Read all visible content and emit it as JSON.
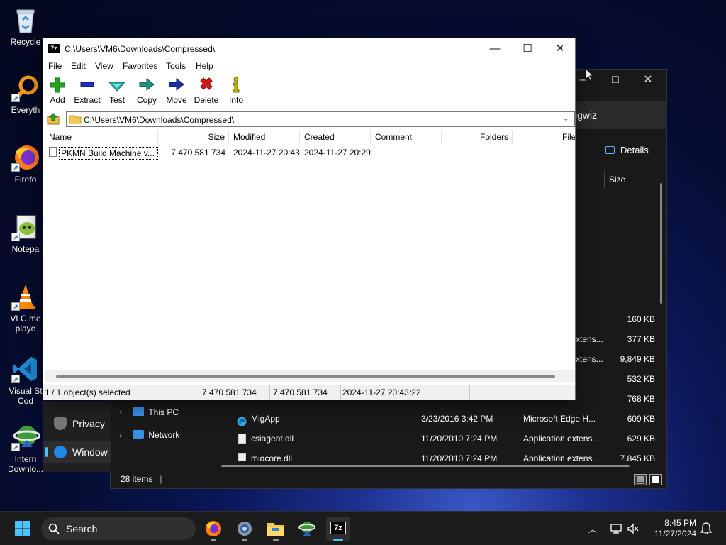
{
  "desktop": {
    "icons": [
      {
        "label": "Recycle",
        "icon": "recycle-bin-icon"
      },
      {
        "label": "Everyth",
        "icon": "everything-search-icon"
      },
      {
        "label": "Firefo",
        "icon": "firefox-icon"
      },
      {
        "label": "Notepa",
        "icon": "notepad-plus-plus-icon"
      },
      {
        "label": "VLC me\nplaye",
        "icon": "vlc-icon"
      },
      {
        "label": "Visual St\nCod",
        "icon": "vscode-icon"
      },
      {
        "label": "Intern\nDownlo...",
        "icon": "internet-download-manager-icon"
      }
    ]
  },
  "background_explorer": {
    "address_fragment": "igwiz",
    "details_label": "Details",
    "size_header": "Size",
    "rows": [
      {
        "name": "",
        "date": "",
        "type": "",
        "size": "160 KB"
      },
      {
        "name": "",
        "date": "",
        "type": "xtens...",
        "size": "377 KB"
      },
      {
        "name": "",
        "date": "",
        "type": "xtens...",
        "size": "9,849 KB"
      },
      {
        "name": "",
        "date": "",
        "type": "",
        "size": "532 KB"
      },
      {
        "name": "",
        "date": "",
        "type": "",
        "size": "768 KB"
      },
      {
        "name": "MigApp",
        "date": "3/23/2016 3:42 PM",
        "type": "Microsoft Edge H...",
        "size": "609 KB"
      },
      {
        "name": "csiagent.dll",
        "date": "11/20/2010 7:24 PM",
        "type": "Application extens...",
        "size": "629 KB"
      },
      {
        "name": "migcore.dll",
        "date": "11/20/2010 7:24 PM",
        "type": "Application extens...",
        "size": "7,845 KB"
      }
    ],
    "nav": [
      {
        "label": "This PC",
        "icon": "this-pc-icon"
      },
      {
        "label": "Network",
        "icon": "network-icon"
      }
    ],
    "status": "28 items"
  },
  "settings_window": {
    "items": [
      {
        "label": "Privacy",
        "icon": "shield-icon"
      },
      {
        "label": "Window",
        "icon": "windows-update-icon"
      }
    ]
  },
  "zip": {
    "title": "C:\\Users\\VM6\\Downloads\\Compressed\\",
    "menu": [
      "File",
      "Edit",
      "View",
      "Favorites",
      "Tools",
      "Help"
    ],
    "toolbar": [
      {
        "label": "Add",
        "icon": "add-plus-icon",
        "color": "#1fa51f"
      },
      {
        "label": "Extract",
        "icon": "extract-minus-icon",
        "color": "#1f2fb8"
      },
      {
        "label": "Test",
        "icon": "test-check-icon",
        "color": "#27b3b3"
      },
      {
        "label": "Copy",
        "icon": "copy-arrow-icon",
        "color": "#1f8f7f"
      },
      {
        "label": "Move",
        "icon": "move-arrow-icon",
        "color": "#1a2fa0"
      },
      {
        "label": "Delete",
        "icon": "delete-x-icon",
        "color": "#d21818"
      },
      {
        "label": "Info",
        "icon": "info-icon",
        "color": "#c6b400"
      }
    ],
    "address": "C:\\Users\\VM6\\Downloads\\Compressed\\",
    "columns": [
      "Name",
      "Size",
      "Modified",
      "Created",
      "Comment",
      "Folders",
      "File"
    ],
    "files": [
      {
        "name": "PKMN Build Machine v...",
        "size": "7 470 581 734",
        "modified": "2024-11-27 20:43",
        "created": "2024-11-27 20:29",
        "comment": "",
        "folders": ""
      }
    ],
    "status": {
      "selected": "1 / 1 object(s) selected",
      "size1": "7 470 581 734",
      "size2": "7 470 581 734",
      "datetime": "2024-11-27 20:43:22"
    }
  },
  "taskbar": {
    "search_placeholder": "Search",
    "apps": [
      {
        "name": "firefox-taskbar-icon",
        "active": false
      },
      {
        "name": "settings-taskbar-icon",
        "active": false
      },
      {
        "name": "file-explorer-taskbar-icon",
        "active": false
      },
      {
        "name": "internet-download-manager-taskbar-icon",
        "active": false
      },
      {
        "name": "7zip-taskbar-icon",
        "active": true
      }
    ],
    "time": "8:45 PM",
    "date": "11/27/2024"
  }
}
